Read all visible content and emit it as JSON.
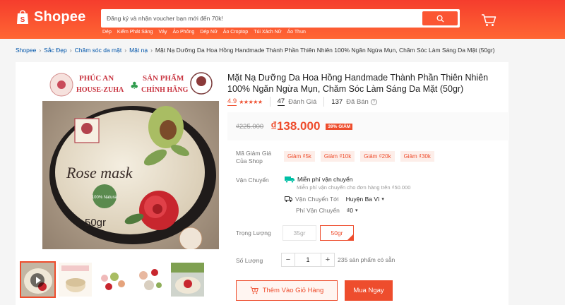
{
  "header": {
    "logo_text": "Shopee",
    "search_placeholder": "Đăng ký và nhận voucher bạn mới đến 70k!",
    "hotwords": [
      "Dép",
      "Kiếm Phát Sáng",
      "Váy",
      "Áo Phông",
      "Dép Nữ",
      "Áo Croptop",
      "Túi Xách Nữ",
      "Áo Thun"
    ]
  },
  "breadcrumb": {
    "items": [
      "Shopee",
      "Sắc Đẹp",
      "Chăm sóc da mặt",
      "Mặt nạ"
    ],
    "current": "Mặt Nạ Dưỡng Da Hoa Hồng Handmade Thành Phần Thiên Nhiên 100% Ngăn Ngừa Mụn, Chăm Sóc Làm Sáng Da Mặt (50gr)"
  },
  "product": {
    "title": "Mặt Nạ Dưỡng Da Hoa Hồng Handmade Thành Phần Thiên Nhiên 100% Ngăn Ngừa Mụn, Chăm Sóc Làm Sáng Da Mặt (50gr)",
    "rating": "4.9",
    "stars": "★★★★★",
    "reviews_count": "47",
    "reviews_label": "Đánh Giá",
    "sold_count": "137",
    "sold_label": "Đã Bán",
    "image": {
      "brand_left": "PHÚC AN",
      "brand_left_2": "HOUSE-ZUHA",
      "brand_right": "SẢN PHẨM",
      "brand_right_2": "CHÍNH HÃNG",
      "jar_label": "Rose mask",
      "jar_weight": "50gr",
      "jar_badge": "100% Natural"
    }
  },
  "price": {
    "original": "₫225.000",
    "current": "₫138.000",
    "discount": "39% GIẢM"
  },
  "vouchers": {
    "label": "Mã Giảm Giá Của Shop",
    "items": [
      "Giảm ₫5k",
      "Giảm ₫10k",
      "Giảm ₫20k",
      "Giảm ₫30k"
    ]
  },
  "shipping": {
    "label": "Vận Chuyển",
    "free_label": "Miễn phí vận chuyển",
    "free_sub": "Miễn phí vận chuyển cho đơn hàng trên ₫50.000",
    "to_label": "Vận Chuyển Tới",
    "to_value": "Huyện Ba Vì",
    "fee_label": "Phí Vận Chuyển",
    "fee_value": "₫0"
  },
  "weight": {
    "label": "Trọng Lượng",
    "options": [
      "35gr",
      "50gr"
    ],
    "selected": "50gr"
  },
  "quantity": {
    "label": "Số Lượng",
    "value": "1",
    "minus": "−",
    "plus": "+",
    "stock": "235 sản phẩm có sẵn"
  },
  "actions": {
    "add_to_cart": "Thêm Vào Giỏ Hàng",
    "buy_now": "Mua Ngay"
  },
  "colors": {
    "brand": "#ee4d2d",
    "header_start": "#f53d2d",
    "header_end": "#ff6633"
  }
}
